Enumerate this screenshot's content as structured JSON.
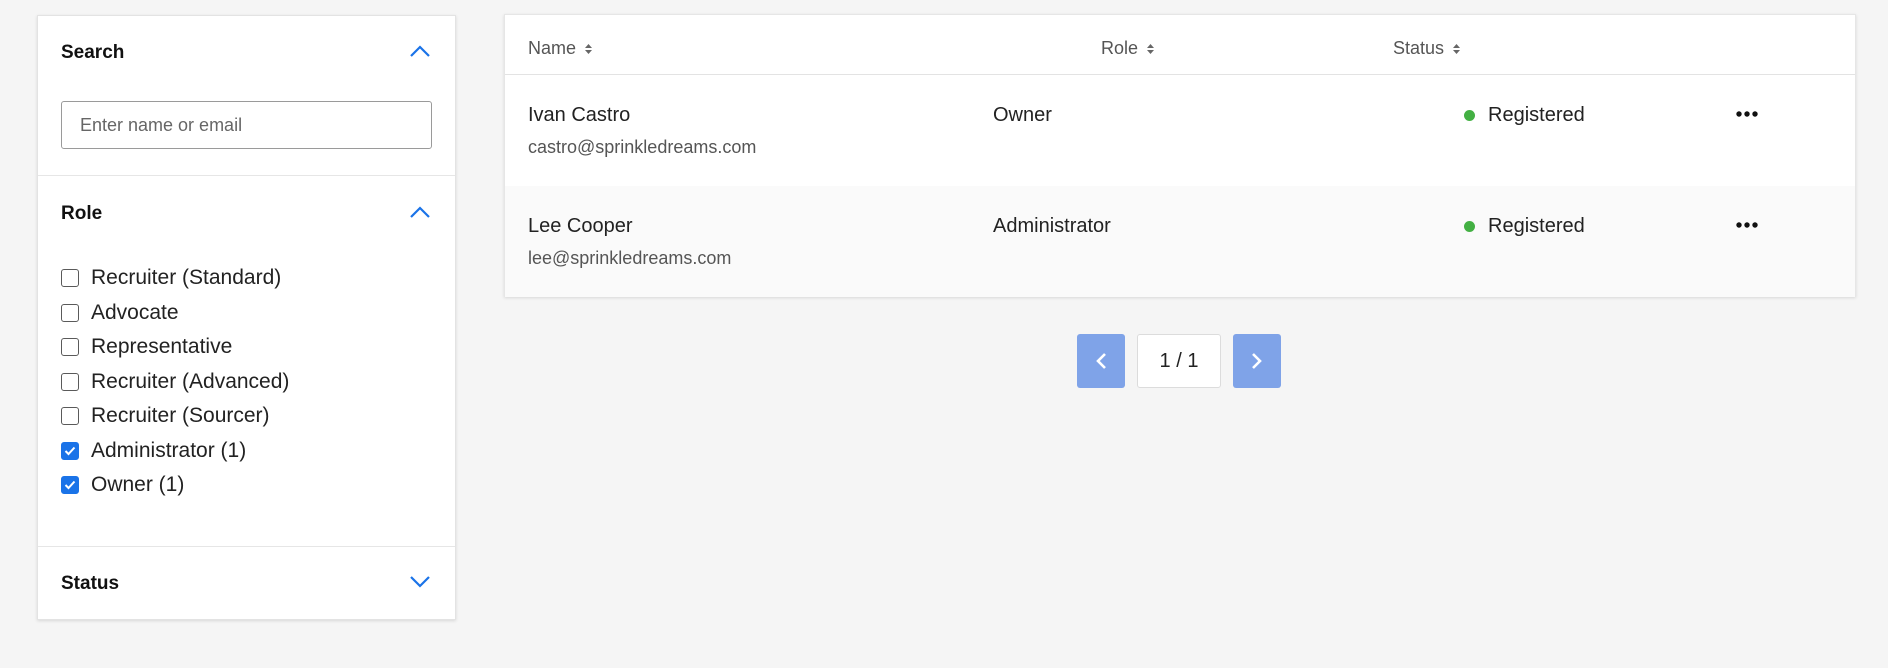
{
  "filters": {
    "search": {
      "title": "Search",
      "placeholder": "Enter name or email",
      "value": ""
    },
    "role": {
      "title": "Role",
      "options": [
        {
          "label": "Recruiter (Standard)",
          "checked": false
        },
        {
          "label": "Advocate",
          "checked": false
        },
        {
          "label": "Representative",
          "checked": false
        },
        {
          "label": "Recruiter (Advanced)",
          "checked": false
        },
        {
          "label": "Recruiter (Sourcer)",
          "checked": false
        },
        {
          "label": "Administrator (1)",
          "checked": true
        },
        {
          "label": "Owner (1)",
          "checked": true
        }
      ]
    },
    "status": {
      "title": "Status"
    }
  },
  "table": {
    "headers": {
      "name": "Name",
      "role": "Role",
      "status": "Status"
    },
    "rows": [
      {
        "name": "Ivan Castro",
        "email": "castro@sprinkledreams.com",
        "role": "Owner",
        "status": "Registered"
      },
      {
        "name": "Lee Cooper",
        "email": "lee@sprinkledreams.com",
        "role": "Administrator",
        "status": "Registered"
      }
    ]
  },
  "pagination": {
    "label": "1 / 1"
  },
  "colors": {
    "accent": "#1a73e8",
    "pager": "#7fa3e8",
    "status_registered": "#43b043"
  }
}
